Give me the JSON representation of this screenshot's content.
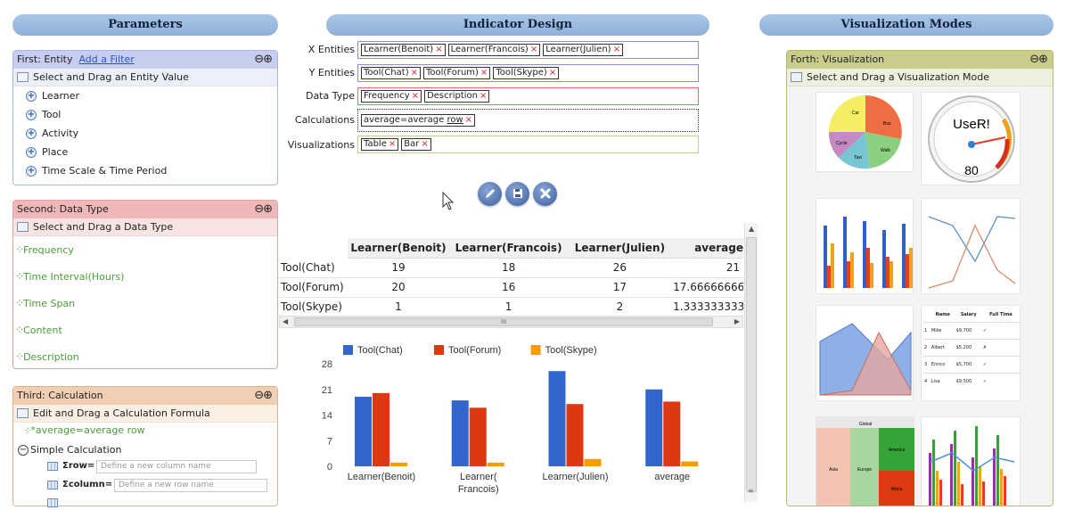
{
  "headers": {
    "parameters": "Parameters",
    "indicator_design": "Indicator Design",
    "visualization_modes": "Visualization Modes"
  },
  "entity_panel": {
    "title": "First: Entity",
    "add_filter": "Add a Filter",
    "instruction": "Select and Drag an Entity Value",
    "items": [
      "Learner",
      "Tool",
      "Activity",
      "Place",
      "Time Scale & Time Period"
    ]
  },
  "datatype_panel": {
    "title": "Second: Data Type",
    "instruction": "Select and Drag a Data Type",
    "items": [
      "Frequency",
      "Time Interval(Hours)",
      "Time Span",
      "Content",
      "Description"
    ]
  },
  "calc_panel": {
    "title": "Third: Calculation",
    "instruction": "Edit and Drag a Calculation Formula",
    "formula": "*average=average row",
    "simple": "Simple Calculation",
    "row_label": "Σrow=",
    "row_placeholder": "Define a new column name",
    "column_label": "Σcolumn=",
    "column_placeholder": "Define a new row name"
  },
  "indicator": {
    "x_label": "X Entities",
    "x_chips": [
      "Learner(Benoit)",
      "Learner(Francois)",
      "Learner(Julien)"
    ],
    "y_label": "Y Entities",
    "y_chips": [
      "Tool(Chat)",
      "Tool(Forum)",
      "Tool(Skype)"
    ],
    "dt_label": "Data Type",
    "dt_chips": [
      "Frequency",
      "Description"
    ],
    "calc_label": "Calculations",
    "calc_chip_main": "average=average",
    "calc_chip_row": "row",
    "vis_label": "Visualizations",
    "vis_chips": [
      "Table",
      "Bar"
    ],
    "remove_symbol": "×"
  },
  "table": {
    "columns": [
      "",
      "Learner(Benoit)",
      "Learner(Francois)",
      "Learner(Julien)",
      "average"
    ],
    "rows": [
      [
        "Tool(Chat)",
        "19",
        "18",
        "26",
        "21"
      ],
      [
        "Tool(Forum)",
        "20",
        "16",
        "17",
        "17.666666666"
      ],
      [
        "Tool(Skype)",
        "1",
        "1",
        "2",
        "1.3333333333"
      ]
    ],
    "scroll_grip": "III"
  },
  "chart_data": {
    "type": "bar",
    "categories": [
      "Learner(Benoit)",
      "Learner(Francois)",
      "Learner(Julien)",
      "average"
    ],
    "category_lines": [
      [
        "Learner(Benoit)"
      ],
      [
        "Learner(",
        "Francois)"
      ],
      [
        "Learner(Julien)"
      ],
      [
        "average"
      ]
    ],
    "series": [
      {
        "name": "Tool(Chat)",
        "values": [
          19,
          18,
          26,
          21
        ],
        "color": "#3366cc"
      },
      {
        "name": "Tool(Forum)",
        "values": [
          20,
          16,
          17,
          17.67
        ],
        "color": "#dc3912"
      },
      {
        "name": "Tool(Skype)",
        "values": [
          1,
          1,
          2,
          1.33
        ],
        "color": "#ff9900"
      }
    ],
    "ylim": [
      0,
      28
    ],
    "yticks": [
      "0",
      "7",
      "14",
      "21",
      "28"
    ],
    "grid": false,
    "legend": "top"
  },
  "vis_panel": {
    "title": "Forth: Visualization",
    "instruction": "Select and Drag a Visualization Mode",
    "pie_labels": [
      "Car",
      "Bus",
      "Cycle",
      "Taxi",
      "Walk"
    ],
    "gauge_label": "UseR!",
    "gauge_value": "80",
    "table_headers": [
      "Name",
      "Salary",
      "Full Time"
    ],
    "table_rows": [
      [
        "1",
        "Mike",
        "$9,700",
        "✓"
      ],
      [
        "2",
        "Albert",
        "$5,200",
        "✗"
      ],
      [
        "3",
        "Enrico",
        "$5,700",
        "✓"
      ],
      [
        "4",
        "Lisa",
        "$9,500",
        "✓"
      ]
    ],
    "treemap_labels": [
      "Global",
      "Asia",
      "Europe",
      "America",
      "Africa"
    ]
  },
  "colors": {
    "entity": "#c7cdef",
    "datatype": "#efb8b8",
    "calculation": "#f1cfb4",
    "visualization": "#c9cc8a",
    "header": "#9fbbe0"
  }
}
